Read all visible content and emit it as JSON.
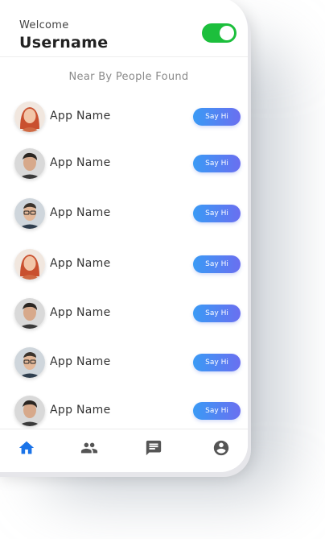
{
  "header": {
    "welcome": "Welcome",
    "username": "Username",
    "toggle_on": true
  },
  "section_title": "Near By People Found",
  "people": [
    {
      "name": "App Name",
      "button": "Say Hi",
      "avatar": "woman-avatar"
    },
    {
      "name": "App Name",
      "button": "Say Hi",
      "avatar": "man-avatar"
    },
    {
      "name": "App Name",
      "button": "Say Hi",
      "avatar": "man-glasses-avatar"
    },
    {
      "name": "App Name",
      "button": "Say Hi",
      "avatar": "woman-avatar"
    },
    {
      "name": "App Name",
      "button": "Say Hi",
      "avatar": "man-avatar"
    },
    {
      "name": "App Name",
      "button": "Say Hi",
      "avatar": "man-glasses-avatar"
    },
    {
      "name": "App Name",
      "button": "Say Hi",
      "avatar": "man-avatar"
    }
  ],
  "nav": [
    {
      "icon": "home-icon",
      "active": true
    },
    {
      "icon": "people-icon",
      "active": false
    },
    {
      "icon": "chat-icon",
      "active": false
    },
    {
      "icon": "account-icon",
      "active": false
    }
  ],
  "colors": {
    "toggle": "#1cbf3c",
    "button_start": "#3a9af5",
    "button_end": "#6a6ff0",
    "nav_active": "#1a73e8",
    "nav_inactive": "#555555"
  }
}
